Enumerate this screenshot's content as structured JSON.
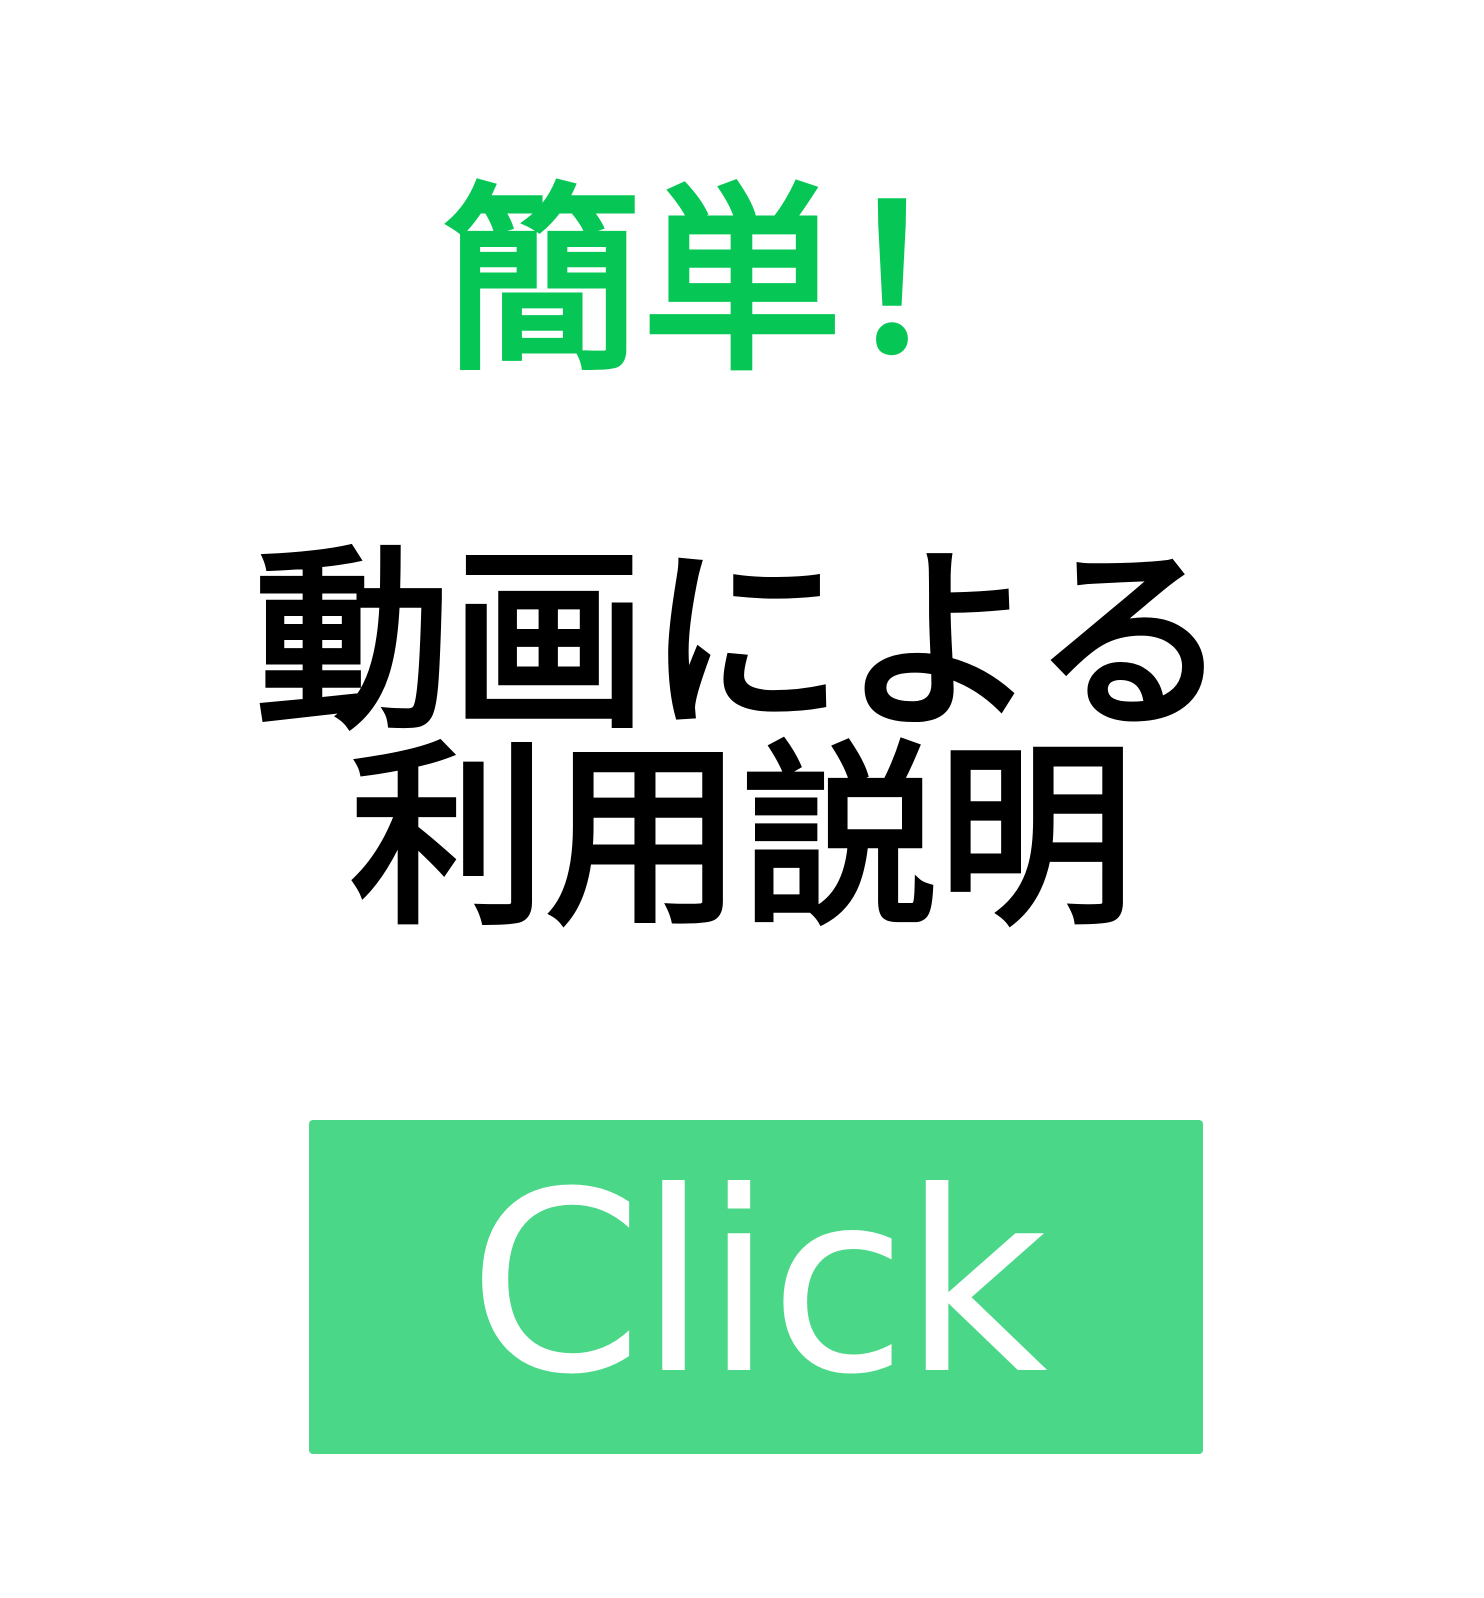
{
  "tagline": "簡単！",
  "title": {
    "line1": "動画による",
    "line2": "利用説明"
  },
  "cta": {
    "label": "Click"
  },
  "colors": {
    "background": "#ffffff",
    "tagline": "#06c755",
    "title": "#000000",
    "button": "#4ad788",
    "button_text": "#ffffff"
  }
}
